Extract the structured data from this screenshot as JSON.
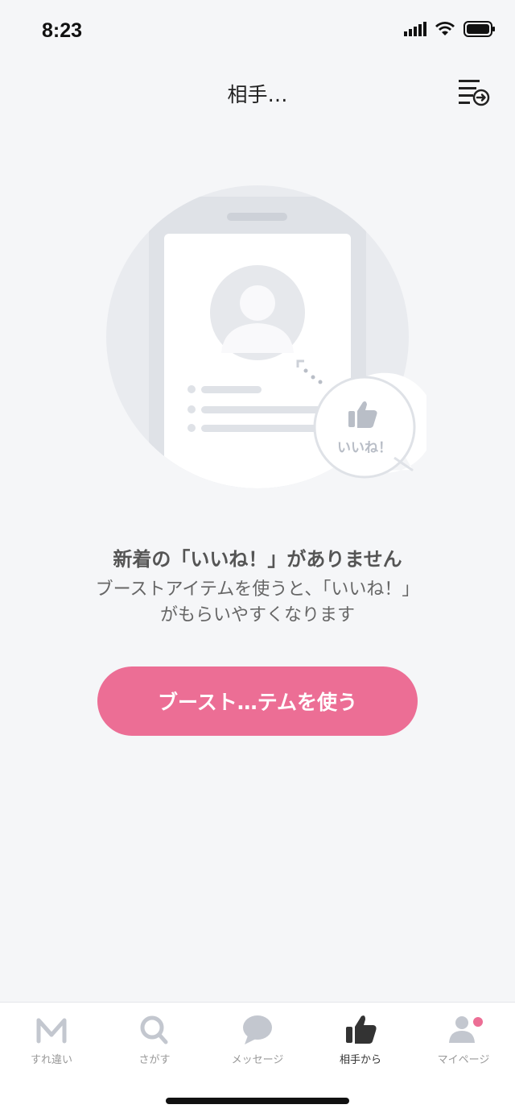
{
  "status_bar": {
    "time": "8:23"
  },
  "header": {
    "title": "相手…"
  },
  "illustration": {
    "bubble_label": "いいね！"
  },
  "empty_state": {
    "title": "新着の「いいね！」がありません",
    "description_line1": "ブーストアイテムを使うと、「いいね！」",
    "description_line2": "がもらいやすくなります"
  },
  "boost_button": {
    "label": "ブースト…テムを使う"
  },
  "tabs": [
    {
      "label": "すれ違い",
      "icon": "crossing-icon",
      "active": false
    },
    {
      "label": "さがす",
      "icon": "search-icon",
      "active": false
    },
    {
      "label": "メッセージ",
      "icon": "chat-bubble-icon",
      "active": false
    },
    {
      "label": "相手から",
      "icon": "thumbs-up-icon",
      "active": true
    },
    {
      "label": "マイページ",
      "icon": "person-icon",
      "active": false
    }
  ],
  "colors": {
    "accent": "#ec6e95",
    "background": "#f5f6f8",
    "inactive": "#c3c7cf"
  }
}
